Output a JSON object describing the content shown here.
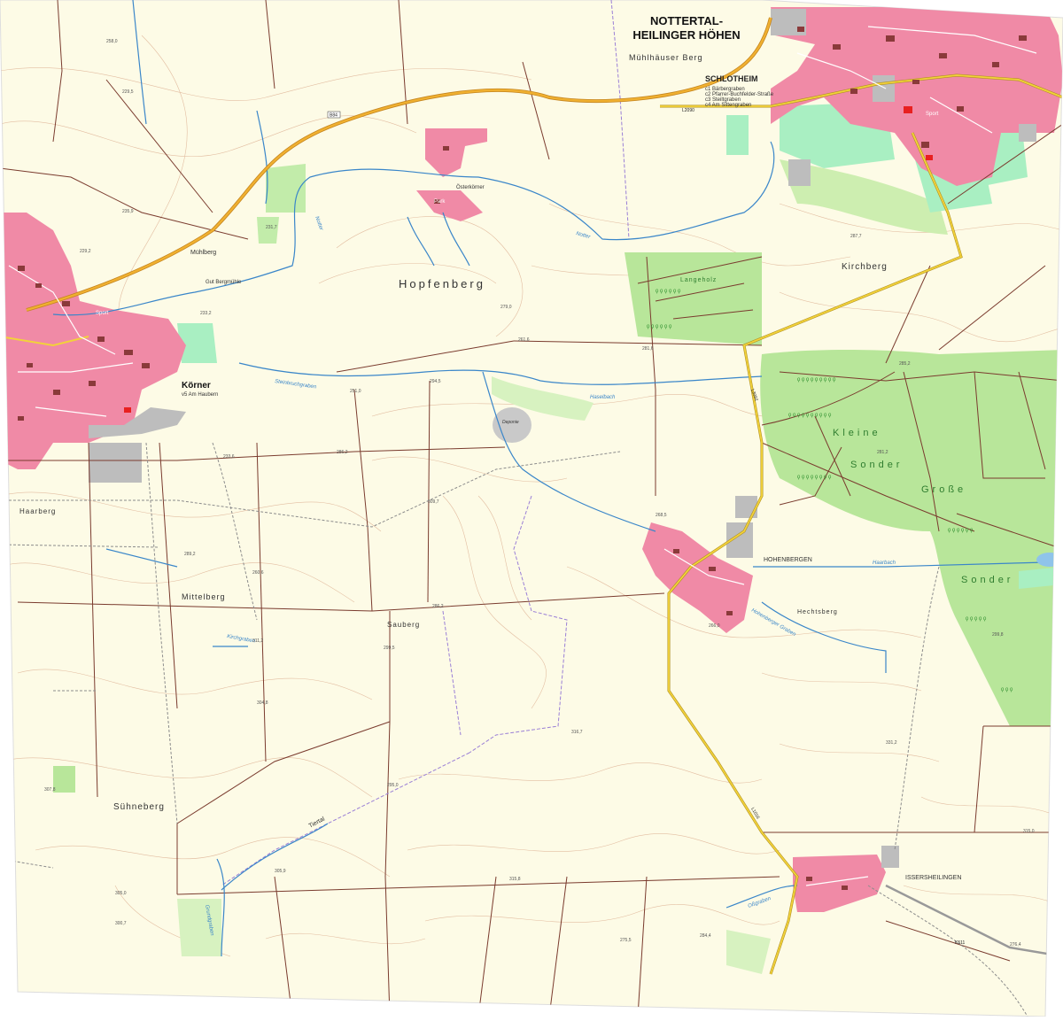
{
  "map": {
    "region_title_line1": "NOTTERTAL-",
    "region_title_line2": "HEILINGER HÖHEN",
    "labels": {
      "muhlhauser_berg": "Mühlhäuser Berg",
      "schlotheim": "SCHLOTHEIM",
      "schlotheim_notes": [
        "c1 Bärbergraben",
        "c2 Pfarrer-Buchfelder-Straße",
        "c3 Steiltgraben",
        "c4 Am Sittengraben"
      ],
      "korner": "Körner",
      "korner_sub": "v5 Am Haubern",
      "osterkorner": "Österkörner",
      "hohenbergen": "HOHENBERGEN",
      "issersheilingen": "ISSERSHEILINGEN",
      "muhlberg": "Mühlberg",
      "gut_bergmuhle": "Gut Bergmühle",
      "hopfenberg": "Hopfenberg",
      "kirchberg": "Kirchberg",
      "langeholz": "Langeholz",
      "kleine": "Kleine",
      "sonder1": "Sonder",
      "grosse": "Große",
      "sonder2": "Sonder",
      "haarberg": "Haarberg",
      "mittelberg": "Mittelberg",
      "sauberg": "Sauberg",
      "hechtsberg": "Hechtsberg",
      "suhneberg": "Sühneberg",
      "tiertal": "Tiertal",
      "deponie": "Deponie",
      "sport": "Sport",
      "park": "Park"
    },
    "water": {
      "notter": "Notter",
      "haselbach": "Haselbach",
      "steinbruchgraben": "Steinbruchgraben",
      "haarbach": "Haarbach",
      "hohenberger_graben": "Hohenberger Graben",
      "ossgraben": "Oßgraben",
      "grundgraben": "Grundgraben",
      "kirchgraben": "Kirchgraben"
    },
    "roads": {
      "b84": "B84",
      "l2090": "L2090",
      "l1016": "L1016",
      "k511": "K511",
      "l3092": "L3092"
    },
    "elevations": {
      "e1": "258,0",
      "e2": "229,5",
      "e3": "235,9",
      "e4": "231,7",
      "e5": "229,2",
      "e6": "233,2",
      "e7": "251,0",
      "e8": "279,0",
      "e9": "261,6",
      "e10": "233,6",
      "e11": "286,2",
      "e12": "309,7",
      "e13": "294,5",
      "e14": "281,6",
      "e15": "268,5",
      "e16": "289,2",
      "e17": "260,6",
      "e18": "286,2",
      "e19": "311,2",
      "e20": "299,5",
      "e21": "304,8",
      "e22": "316,7",
      "e23": "295,0",
      "e24": "307,8",
      "e25": "305,0",
      "e26": "300,7",
      "e27": "305,9",
      "e28": "331,2",
      "e29": "315,0",
      "e30": "276,4",
      "e31": "266,0",
      "e32": "284,4",
      "e33": "287,7",
      "e34": "281,2",
      "e35": "285,2",
      "e36": "299,8",
      "e37": "275,5",
      "e38": "315,8"
    }
  },
  "colors": {
    "background": "#fdfbe6",
    "settlement": "#f08aa6",
    "forest": "#b8e69a",
    "meadow": "#a9efc2",
    "water": "#3a86c9",
    "major_road": "#e0a020",
    "minor_road": "#f2d23a",
    "path": "#7a3b2e",
    "contour": "#d8a68a",
    "boundary": "#9a7fd6",
    "industrial": "#bdbdbd"
  }
}
